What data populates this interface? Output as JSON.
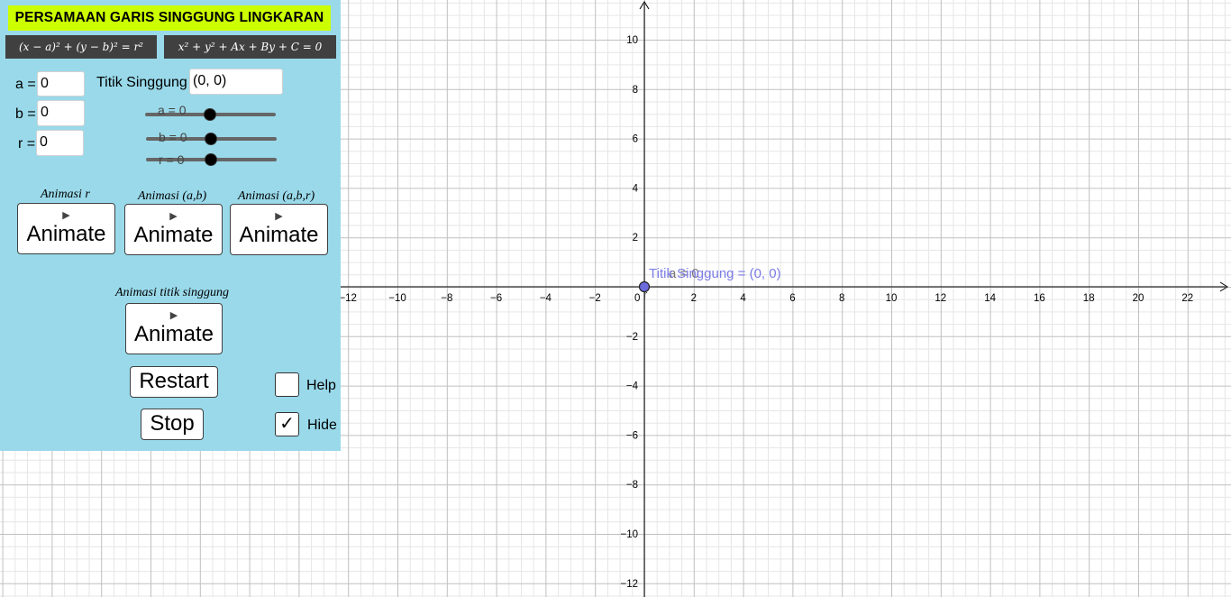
{
  "panel": {
    "title": "PERSAMAAN GARIS SINGGUNG LINGKARAN",
    "formula1": "(x − a)² + (y − b)² = r²",
    "formula2": "x² + y² + Ax + By + C = 0",
    "inputs": {
      "a_label": "a =",
      "a_value": "0",
      "b_label": "b =",
      "b_value": "0",
      "r_label": "r =",
      "r_value": "0",
      "tangent_label": "Titik Singgung",
      "tangent_value": "(0, 0)"
    },
    "sliders": {
      "a_label": "a = 0",
      "a_value": 0,
      "b_label": "b = 0",
      "b_value": 0,
      "r_label": "r = 0",
      "r_value": 0
    },
    "animations": {
      "r_caption": "Animasi r",
      "ab_caption": "Animasi (a,b)",
      "abr_caption": "Animasi (a,b,r)",
      "point_caption": "Animasi titik singgung",
      "button_label": "Animate",
      "play_glyph": "▶"
    },
    "restart_label": "Restart",
    "stop_label": "Stop",
    "help_label": "Help",
    "help_checked": false,
    "hide_label": "Hide",
    "hide_checked": true,
    "check_glyph": "✓"
  },
  "graph": {
    "x_ticks": [
      "−12",
      "−10",
      "−8",
      "−6",
      "−4",
      "−2",
      "0",
      "2",
      "4",
      "6",
      "8",
      "10",
      "12",
      "14",
      "16",
      "18",
      "20",
      "22"
    ],
    "y_ticks_pos": [
      "2",
      "4",
      "6",
      "8",
      "10"
    ],
    "y_ticks_neg": [
      "−2",
      "−4",
      "−6",
      "−8",
      "−10",
      "−12"
    ],
    "point_label": "Titik Singgung = (0, 0)",
    "overlap_label": "a = 0",
    "r_label": "r",
    "colors": {
      "grid_minor": "#e6e6e6",
      "grid_major": "#c0c0c0",
      "axis": "#000000",
      "point": "#6b6bde",
      "point_label": "#7b7be6"
    }
  }
}
